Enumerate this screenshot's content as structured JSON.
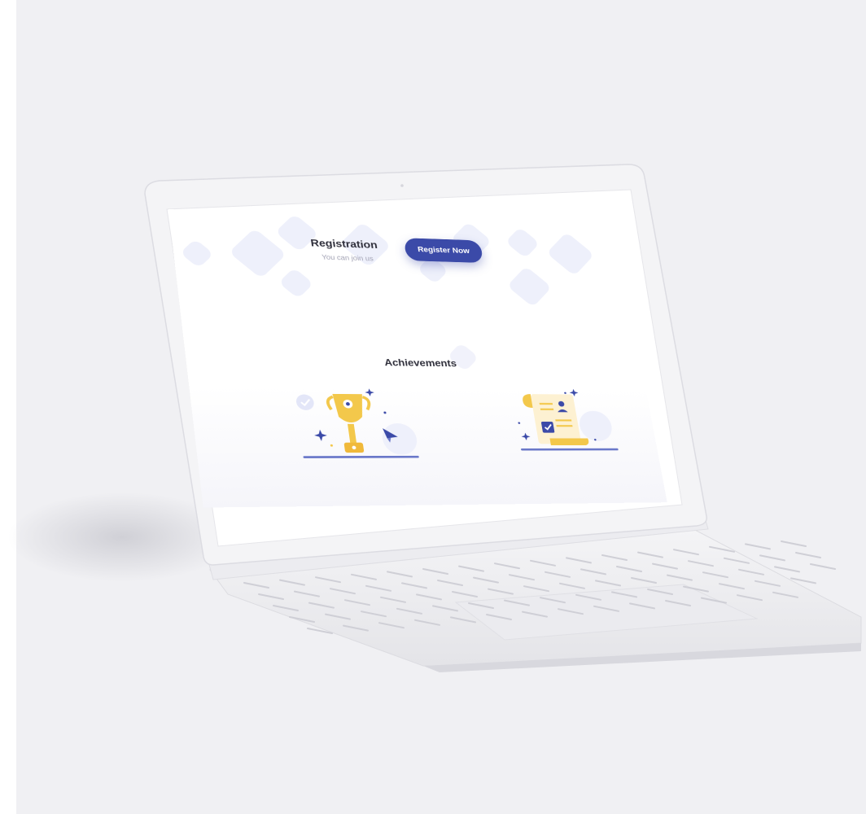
{
  "registration": {
    "title": "Registration",
    "subtitle": "You can join us",
    "button_label": "Register Now"
  },
  "achievements": {
    "title": "Achievements",
    "illustrations": [
      "trophy-illustration",
      "certificate-illustration"
    ]
  },
  "colors": {
    "primary": "#3b4aa8",
    "accent_gold": "#f3c84b",
    "shape_tint": "#eef0fb",
    "backdrop": "#f0f0f3"
  }
}
